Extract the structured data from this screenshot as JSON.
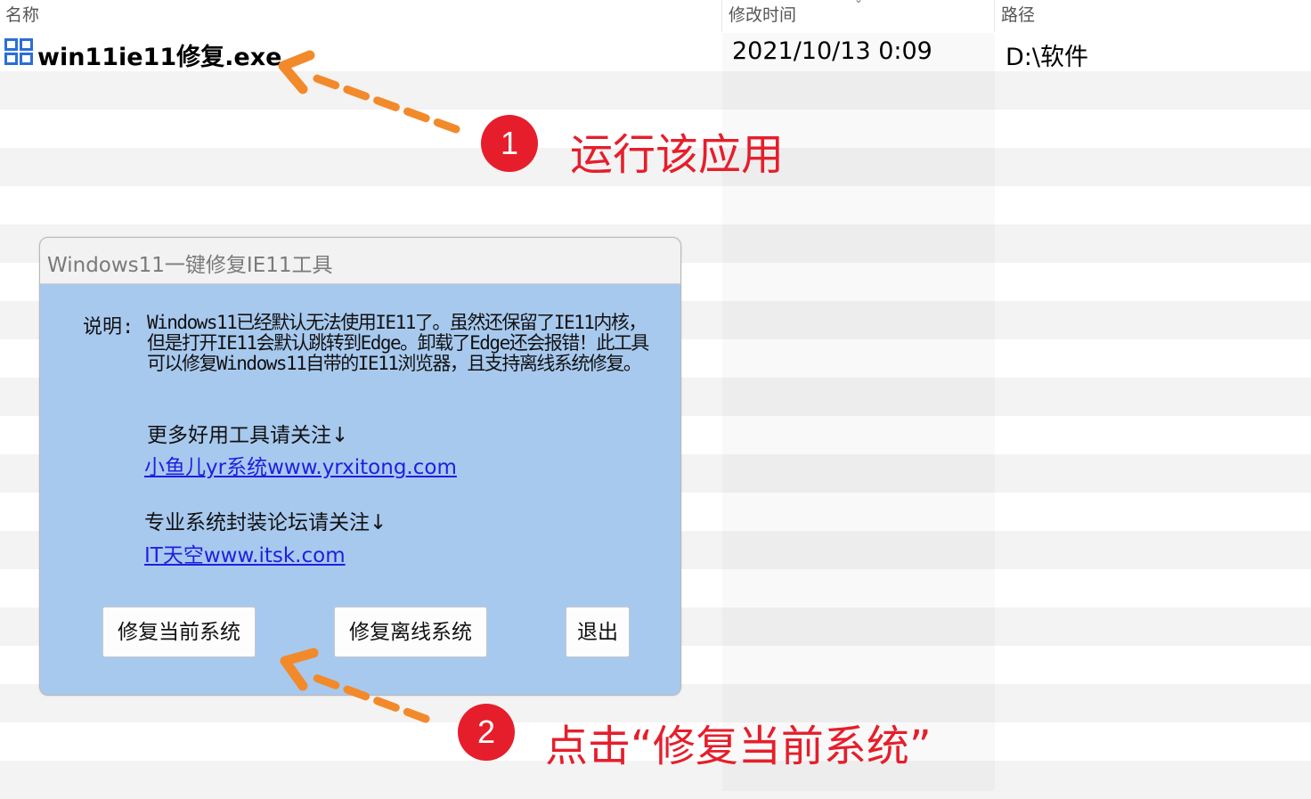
{
  "explorer": {
    "columns": {
      "name": "名称",
      "modified": "修改时间",
      "path": "路径"
    },
    "file": {
      "name": "win11ie11修复.exe",
      "modified": "2021/10/13 0:09",
      "path": "D:\\软件"
    }
  },
  "dialog": {
    "title": "Windows11一键修复IE11工具",
    "desc_label": "说明:",
    "desc_text": "Windows11已经默认无法使用IE11了。虽然还保留了IE11内核，但是打开IE11会默认跳转到Edge。卸载了Edge还会报错！此工具可以修复Windows11自带的IE11浏览器，且支持离线系统修复。",
    "more_tools": "更多好用工具请关注↓",
    "link1": "小鱼儿yr系统www.yrxitong.com",
    "forum": "专业系统封装论坛请关注↓",
    "link2": "IT天空www.itsk.com",
    "buttons": {
      "repair_current": "修复当前系统",
      "repair_offline": "修复离线系统",
      "exit": "退出"
    }
  },
  "annotations": {
    "step1": {
      "number": "1",
      "text": "运行该应用"
    },
    "step2": {
      "number": "2",
      "text": "点击“修复当前系统”"
    }
  },
  "colors": {
    "annotation_red": "#e61e2b",
    "arrow_orange": "#f28a2b",
    "dialog_bg": "#a8c9ee",
    "link": "#1f1fe0"
  }
}
